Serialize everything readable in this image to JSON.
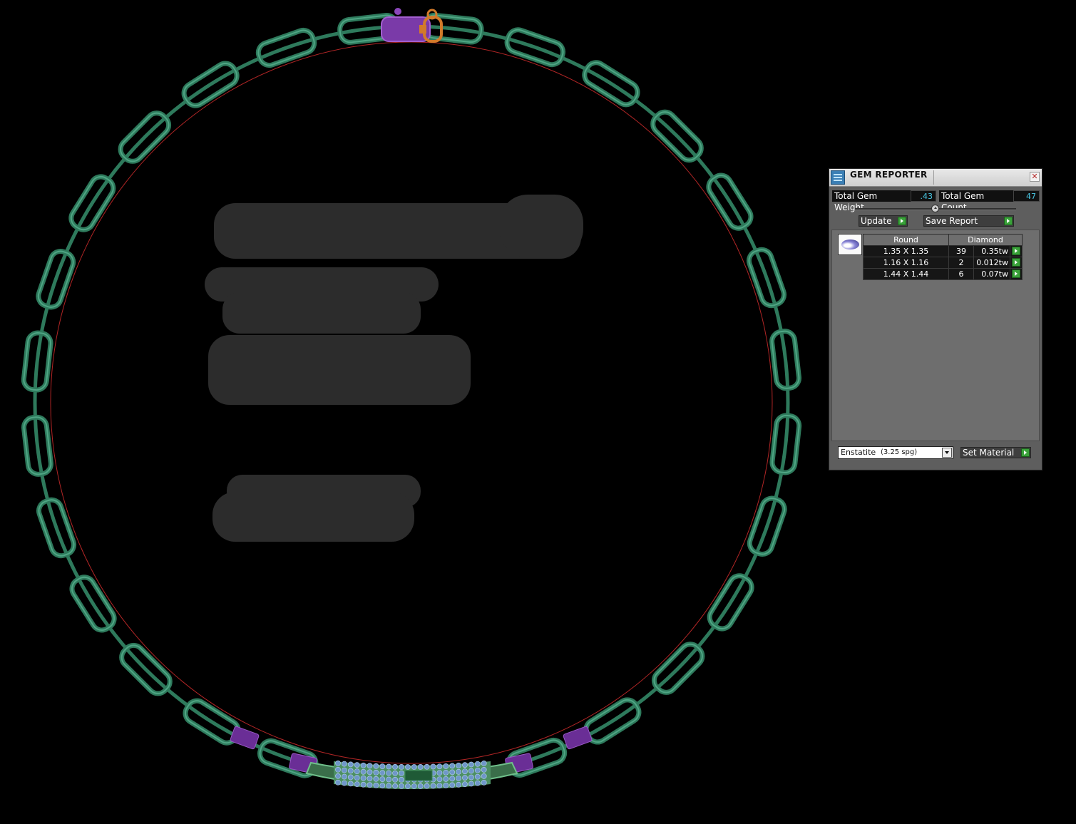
{
  "panel": {
    "title": "GEM REPORTER",
    "close_glyph": "✕",
    "total_gem_weight_label": "Total Gem Weight",
    "total_gem_weight_value": ".43",
    "total_gem_count_label": "Total Gem Count",
    "total_gem_count_value": "47",
    "update_label": "Update",
    "save_report_label": "Save Report",
    "table": {
      "headers": [
        "Round",
        "Diamond"
      ],
      "rows": [
        {
          "size": "1.35 X 1.35",
          "count": "39",
          "weight": "0.35tw"
        },
        {
          "size": "1.16 X 1.16",
          "count": "2",
          "weight": "0.012tw"
        },
        {
          "size": "1.44 X 1.44",
          "count": "6",
          "weight": "0.07tw"
        }
      ]
    },
    "material": {
      "name": "Enstatite",
      "spg": "(3.25 spg)"
    },
    "set_material_label": "Set Material"
  },
  "colors": {
    "chain": "#2e7a5c",
    "chain_highlight": "#4fa584",
    "clasp_purple": "#7a3aa8",
    "clasp_orange": "#d27a2a",
    "guide_circle": "#b02525",
    "gem_blue": "#6f97c9",
    "accent_green": "#3aa23a",
    "value_cyan": "#49c9e6"
  },
  "icons": [
    "app-icon",
    "close-icon",
    "slider-thumb-icon",
    "arrow-right-icon",
    "dropdown-arrow-icon",
    "gem-round-icon"
  ]
}
